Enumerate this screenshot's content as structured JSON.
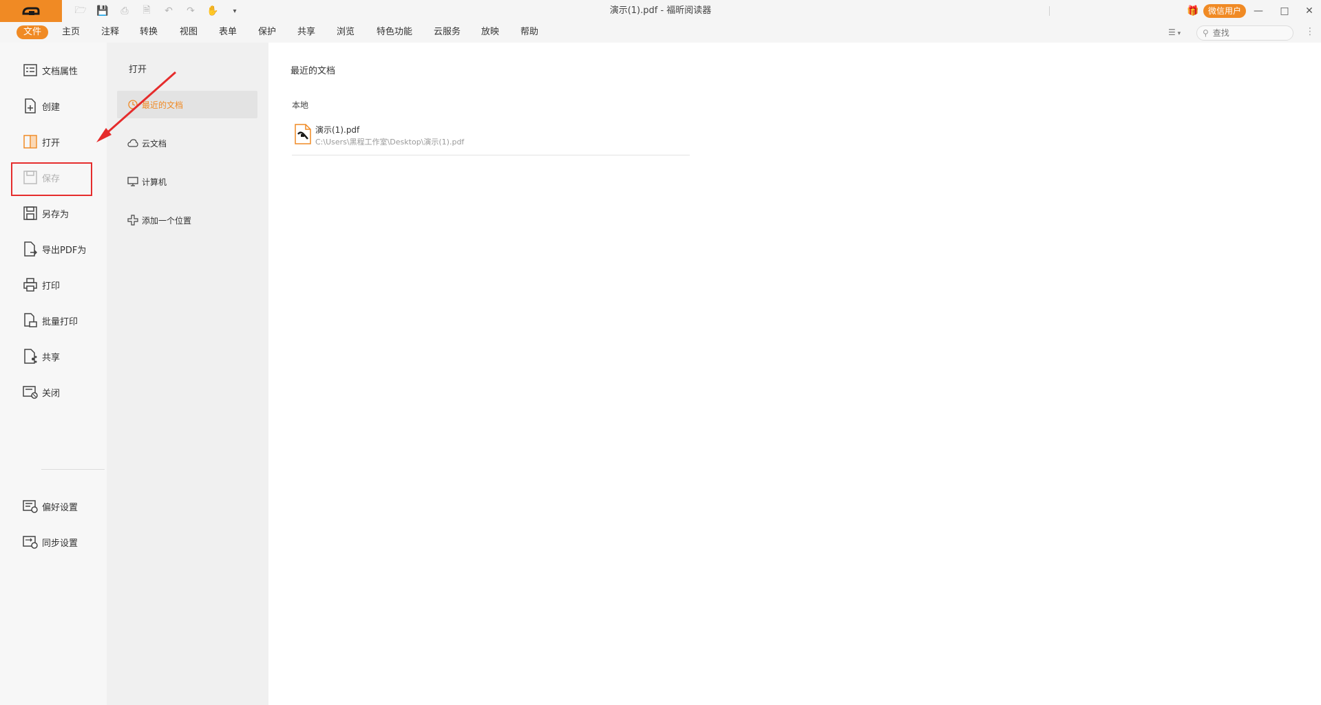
{
  "window": {
    "title": "演示(1).pdf - 福昕阅读器",
    "user_label": "微信用户"
  },
  "menu": {
    "items": [
      "文件",
      "主页",
      "注释",
      "转换",
      "视图",
      "表单",
      "保护",
      "共享",
      "浏览",
      "特色功能",
      "云服务",
      "放映",
      "帮助"
    ],
    "active_index": 0,
    "search_placeholder": "查找"
  },
  "sidebar": {
    "items": [
      {
        "label": "文档属性",
        "icon": "document-properties-icon",
        "enabled": true
      },
      {
        "label": "创建",
        "icon": "create-icon",
        "enabled": true
      },
      {
        "label": "打开",
        "icon": "open-icon",
        "enabled": true
      },
      {
        "label": "保存",
        "icon": "save-icon",
        "enabled": false
      },
      {
        "label": "另存为",
        "icon": "save-as-icon",
        "enabled": true
      },
      {
        "label": "导出PDF为",
        "icon": "export-pdf-icon",
        "enabled": true
      },
      {
        "label": "打印",
        "icon": "print-icon",
        "enabled": true
      },
      {
        "label": "批量打印",
        "icon": "batch-print-icon",
        "enabled": true
      },
      {
        "label": "共享",
        "icon": "share-icon",
        "enabled": true
      },
      {
        "label": "关闭",
        "icon": "close-document-icon",
        "enabled": true
      }
    ],
    "bottom_items": [
      {
        "label": "偏好设置",
        "icon": "preferences-icon"
      },
      {
        "label": "同步设置",
        "icon": "sync-settings-icon"
      }
    ]
  },
  "open_panel": {
    "title": "打开",
    "items": [
      {
        "label": "最近的文档",
        "icon": "clock-icon",
        "selected": true
      },
      {
        "label": "云文档",
        "icon": "cloud-icon",
        "selected": false
      },
      {
        "label": "计算机",
        "icon": "computer-icon",
        "selected": false
      },
      {
        "label": "添加一个位置",
        "icon": "plus-icon",
        "selected": false
      }
    ]
  },
  "recent": {
    "title": "最近的文档",
    "section": "本地",
    "files": [
      {
        "name": "演示(1).pdf",
        "path": "C:\\Users\\黑程工作室\\Desktop\\演示(1).pdf"
      }
    ]
  },
  "colors": {
    "accent": "#f08a24",
    "highlight_box": "#e52c2c"
  }
}
